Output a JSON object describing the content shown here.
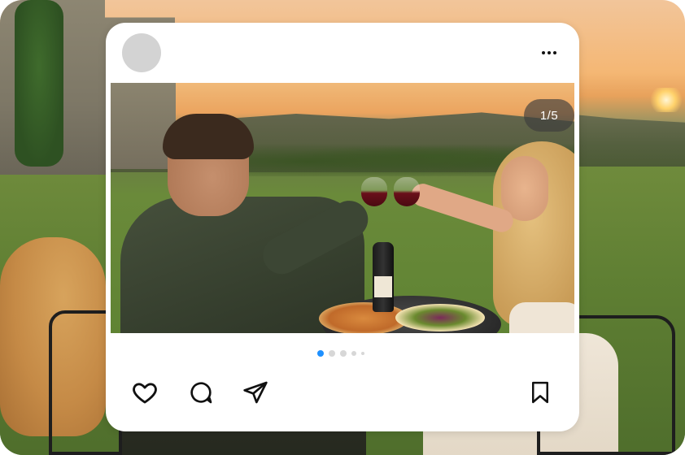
{
  "post": {
    "counter_text": "1/5",
    "carousel": {
      "total": 5,
      "active_index": 0
    }
  },
  "icons": {
    "more": "more-horizontal-icon",
    "like": "heart-icon",
    "comment": "comment-bubble-icon",
    "share": "send-icon",
    "save": "bookmark-icon"
  },
  "colors": {
    "accent": "#1e90ff",
    "card_bg": "#ffffff",
    "badge_bg": "#3c3c3c"
  }
}
